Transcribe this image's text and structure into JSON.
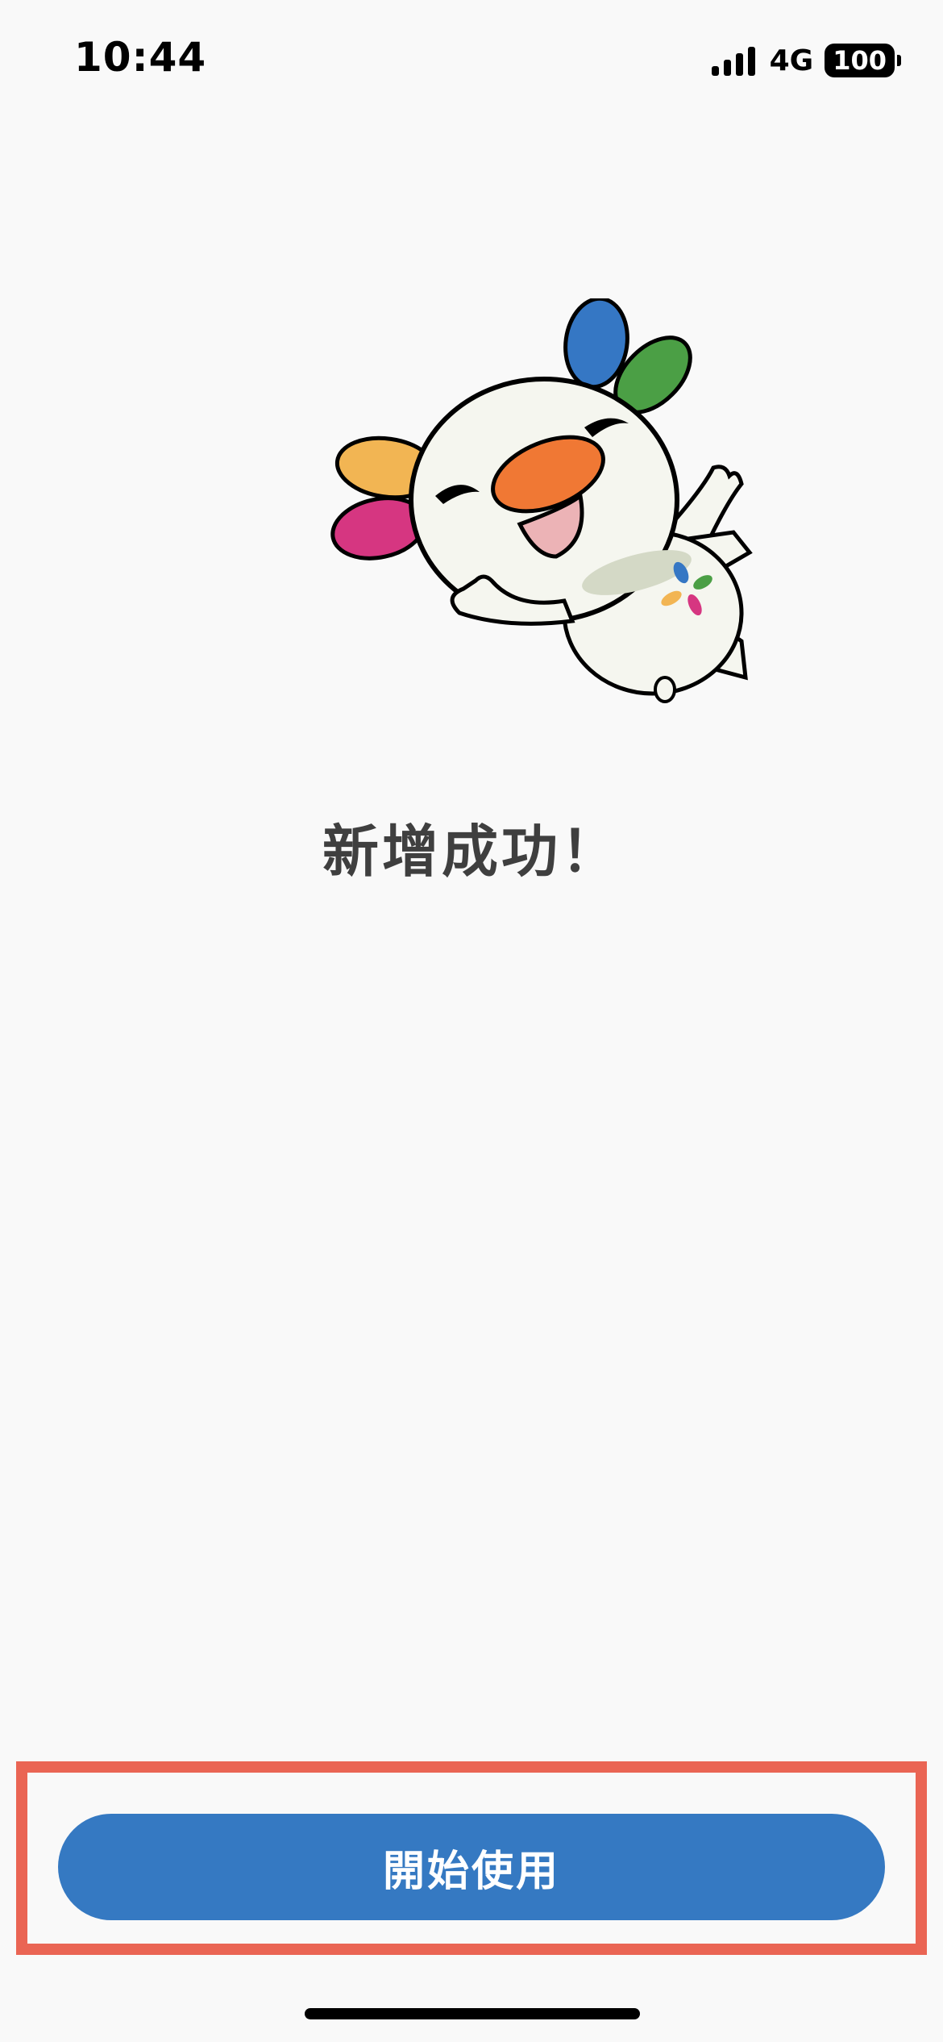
{
  "status_bar": {
    "time": "10:44",
    "network": "4G",
    "battery": "100",
    "signal_icon": "cellular-signal-icon"
  },
  "mascot": {
    "icon": "mascot-illustration",
    "colors": {
      "blue": "#3577c4",
      "green": "#4b9f45",
      "yellow": "#f2b553",
      "pink": "#d63681",
      "orange": "#f07834",
      "body": "#f5f6ef"
    }
  },
  "main": {
    "title": "新增成功！"
  },
  "footer": {
    "start_button_label": "開始使用"
  },
  "colors": {
    "accent": "#3579c2",
    "highlight": "#ea6554",
    "background": "#f9f9f9"
  }
}
